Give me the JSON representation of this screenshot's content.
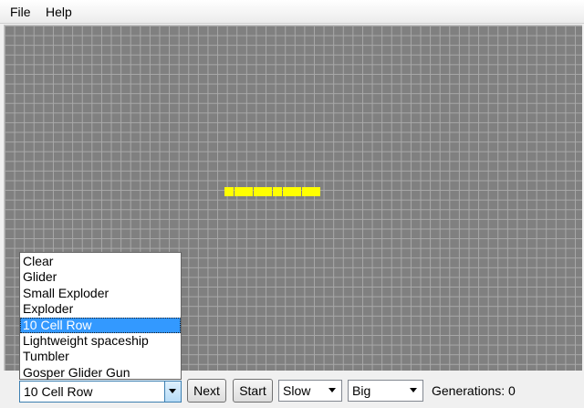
{
  "menu": {
    "file": "File",
    "help": "Help"
  },
  "grid": {
    "cell_color": "#ffff00",
    "background_color": "#808080",
    "line_color": "#a9a9a9",
    "live_cells_count": 10
  },
  "pattern_select": {
    "value": "10 Cell Row",
    "options": [
      "Clear",
      "Glider",
      "Small Exploder",
      "Exploder",
      "10 Cell Row",
      "Lightweight spaceship",
      "Tumbler",
      "Gosper Glider Gun"
    ],
    "selected_index": 4
  },
  "buttons": {
    "next": "Next",
    "start": "Start"
  },
  "speed_select": {
    "value": "Slow"
  },
  "size_select": {
    "value": "Big"
  },
  "generations_label": "Generations: 0",
  "colors": {
    "selection": "#3399ff"
  }
}
